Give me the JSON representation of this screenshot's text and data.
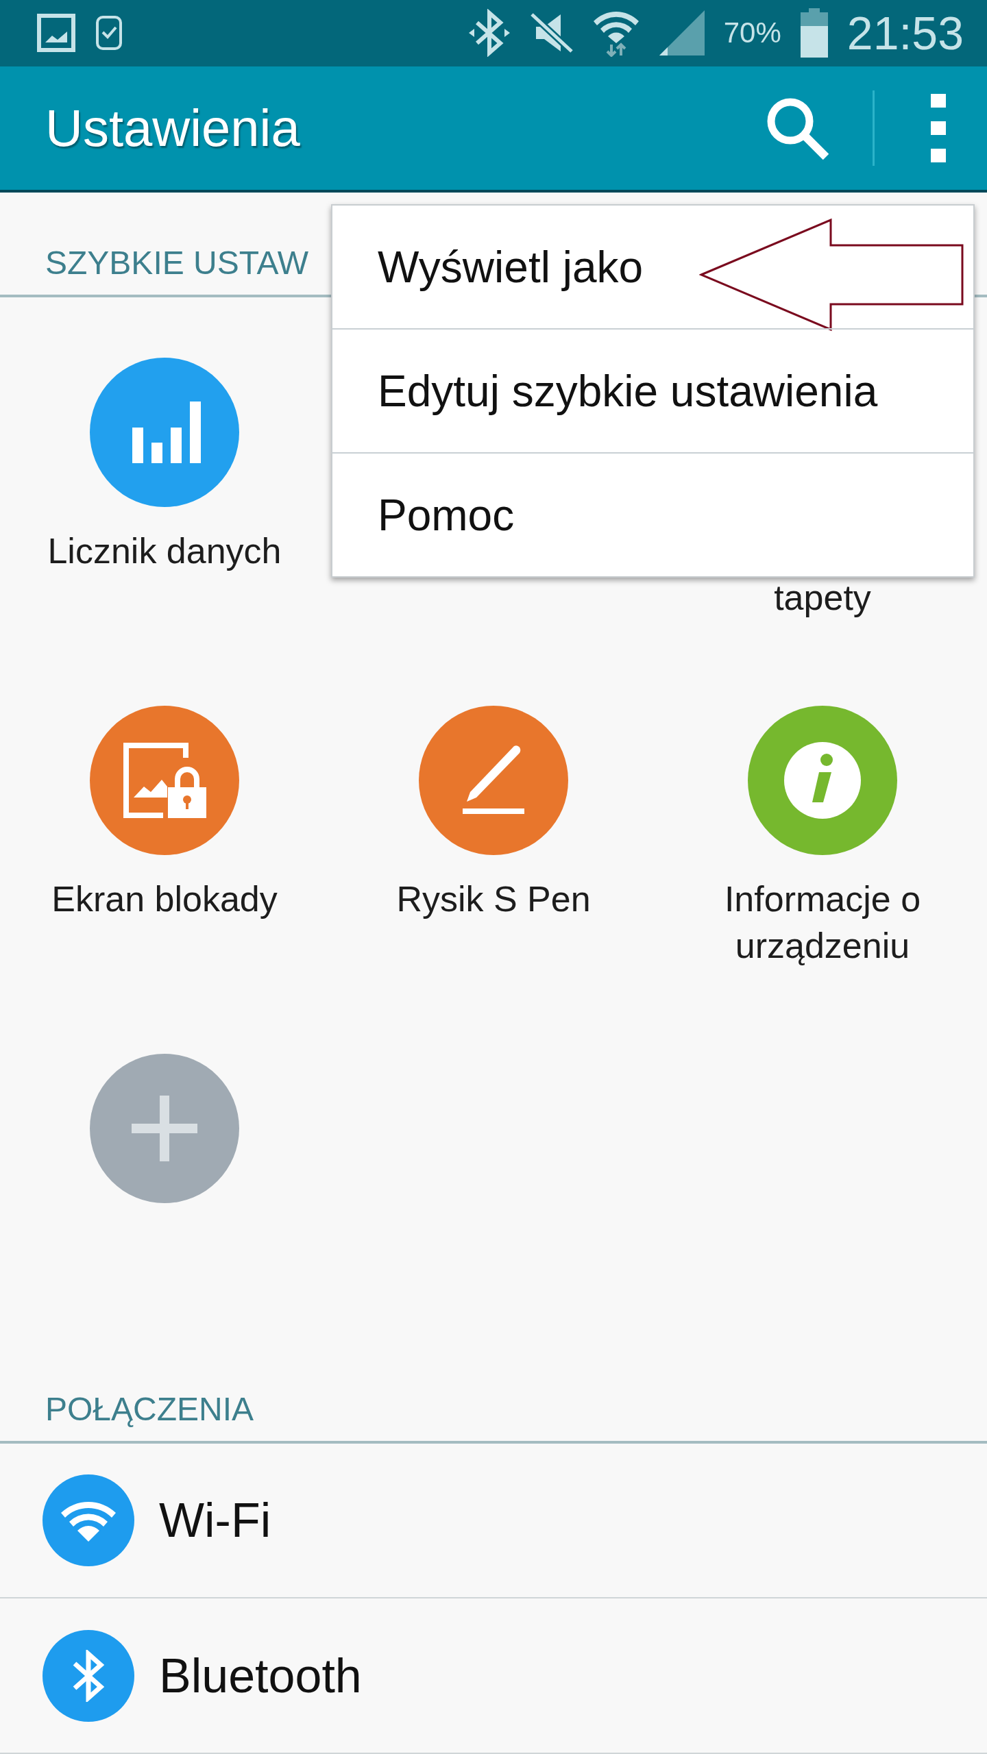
{
  "status_bar": {
    "battery": "70%",
    "time": "21:53"
  },
  "app_bar": {
    "title": "Ustawienia"
  },
  "quick_settings": {
    "header": "SZYBKIE USTAW",
    "tiles": [
      {
        "kind": "data",
        "label": "Licznik danych"
      },
      {
        "kind": "covered"
      },
      {
        "kind": "covered",
        "label_second_line": "tapety"
      },
      {
        "kind": "lock",
        "label": "Ekran blokady"
      },
      {
        "kind": "pen",
        "label": "Rysik S Pen"
      },
      {
        "kind": "info",
        "label": "Informacje o urządzeniu"
      },
      {
        "kind": "add"
      }
    ]
  },
  "connections": {
    "header": "POŁĄCZENIA",
    "items": [
      {
        "kind": "wifi",
        "label": "Wi-Fi"
      },
      {
        "kind": "bluetooth",
        "label": "Bluetooth"
      }
    ]
  },
  "overflow_menu": {
    "items": [
      {
        "label": "Wyświetl jako",
        "pointed": true
      },
      {
        "label": "Edytuj szybkie ustawienia",
        "pointed": false
      },
      {
        "label": "Pomoc",
        "pointed": false
      }
    ]
  }
}
